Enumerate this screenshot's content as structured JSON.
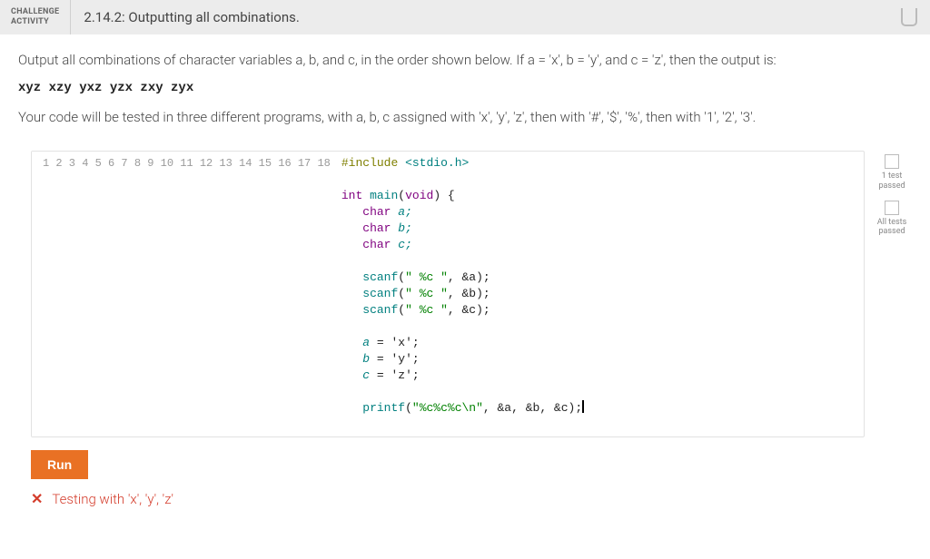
{
  "header": {
    "label_line1": "CHALLENGE",
    "label_line2": "ACTIVITY",
    "title": "2.14.2: Outputting all combinations."
  },
  "problem": {
    "instructions_1": "Output all combinations of character variables a, b, and c, in the order shown below. If a = 'x', b = 'y', and c = 'z', then the output is:",
    "example_output": "xyz xzy yxz yzx zxy zyx",
    "instructions_2": "Your code will be tested in three different programs, with a, b, c assigned with 'x', 'y', 'z', then with '#', '$', '%', then with '1', '2', '3'."
  },
  "code": {
    "line_count": 18,
    "lines": {
      "l1": {
        "hash": "#",
        "include": "include",
        "hdr": " <stdio.h>"
      },
      "l3": {
        "kw1": "int",
        "fn": " main",
        "lp": "(",
        "kw2": "void",
        "rp": ") {"
      },
      "l4": {
        "kw": "char",
        "rest": " a;"
      },
      "l5": {
        "kw": "char",
        "rest": " b;"
      },
      "l6": {
        "kw": "char",
        "rest": " c;"
      },
      "l8": {
        "fn": "scanf",
        "lp": "(",
        "str": "\" %c \"",
        "rest": ", &a);"
      },
      "l9": {
        "fn": "scanf",
        "lp": "(",
        "str": "\" %c \"",
        "rest": ", &b);"
      },
      "l10": {
        "fn": "scanf",
        "lp": "(",
        "str": "\" %c \"",
        "rest": ", &c);"
      },
      "l12": {
        "id": "a",
        "rest": " = 'x';"
      },
      "l13": {
        "id": "b",
        "rest": " = 'y';"
      },
      "l14": {
        "id": "c",
        "rest": " = 'z';"
      },
      "l16": {
        "fn": "printf",
        "lp": "(",
        "str": "\"%c%c%c\\n\"",
        "rest": ", &a, &b, &c);"
      }
    }
  },
  "status": {
    "s1": "1 test passed",
    "s2": "All tests passed"
  },
  "run_label": "Run",
  "result": {
    "text": "Testing with 'x', 'y', 'z'"
  }
}
